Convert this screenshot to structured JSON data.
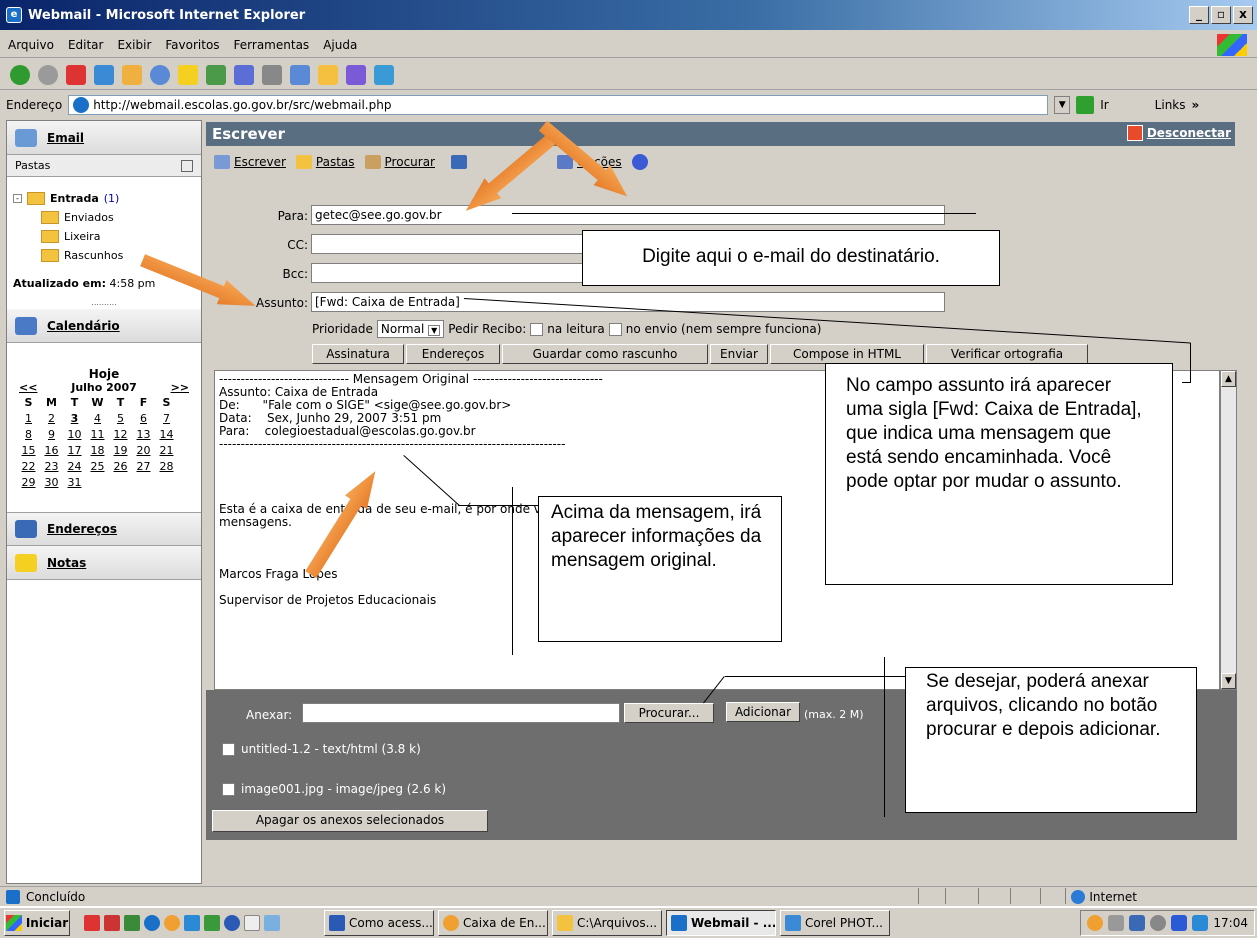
{
  "window": {
    "title": "Webmail - Microsoft Internet Explorer",
    "min": "_",
    "max": "\u0019",
    "close": "x"
  },
  "menu": [
    "Arquivo",
    "Editar",
    "Exibir",
    "Favoritos",
    "Ferramentas",
    "Ajuda"
  ],
  "address": {
    "label": "Endereço",
    "url": "http://webmail.escolas.go.gov.br/src/webmail.php",
    "go": "Ir",
    "links": "Links"
  },
  "left": {
    "email": "Email",
    "pastas": "Pastas",
    "folders": [
      {
        "name": "Entrada",
        "count": "(1)"
      },
      {
        "name": "Enviados"
      },
      {
        "name": "Lixeira"
      },
      {
        "name": "Rascunhos"
      }
    ],
    "updated_label": "Atualizado em:",
    "updated_time": "4:58 pm",
    "dots": "..........",
    "calendario": "Calendário",
    "hoje": "Hoje",
    "month": "Julho 2007",
    "prev": "<<",
    "next": ">>",
    "weekdays": [
      "S",
      "M",
      "T",
      "W",
      "T",
      "F",
      "S"
    ],
    "weeks": [
      [
        "1",
        "2",
        "3",
        "4",
        "5",
        "6",
        "7"
      ],
      [
        "8",
        "9",
        "10",
        "11",
        "12",
        "13",
        "14"
      ],
      [
        "15",
        "16",
        "17",
        "18",
        "19",
        "20",
        "21"
      ],
      [
        "22",
        "23",
        "24",
        "25",
        "26",
        "27",
        "28"
      ],
      [
        "29",
        "30",
        "31",
        "",
        "",
        "",
        ""
      ]
    ],
    "enderecos": "Endereços",
    "notas": "Notas"
  },
  "main": {
    "title": "Escrever",
    "disconnect": "Desconectar",
    "tb": [
      "Escrever",
      "Pastas",
      "Procurar",
      "Opções"
    ]
  },
  "form": {
    "para_label": "Para:",
    "para": "getec@see.go.gov.br",
    "cc_label": "CC:",
    "bcc_label": "Bcc:",
    "assunto_label": "Assunto:",
    "assunto": "[Fwd: Caixa de Entrada]",
    "prioridade": "Prioridade",
    "prioridade_val": "Normal",
    "pedir": "Pedir Recibo:",
    "na_leitura": "na leitura",
    "no_envio": "no envio (nem sempre funciona)",
    "buttons": [
      "Assinatura",
      "Endereços",
      "Guardar como rascunho",
      "Enviar",
      "Compose in HTML",
      "Verificar ortografia"
    ]
  },
  "message": {
    "lines": [
      "------------------------------ Mensagem Original ------------------------------",
      "Assunto: Caixa de Entrada",
      "De:      \"Fale com o SIGE\" <sige@see.go.gov.br>",
      "Data:    Sex, Junho 29, 2007 3:51 pm",
      "Para:    colegioestadual@escolas.go.gov.br",
      "--------------------------------------------------------------------------------",
      "",
      "",
      "",
      "",
      "Esta é a caixa de entrada de seu e-mail, é por onde v",
      "mensagens.",
      "",
      "",
      "",
      "Marcos Fraga Lopes",
      "",
      "Supervisor de Projetos Educacionais"
    ]
  },
  "attach": {
    "label": "Anexar:",
    "procurar": "Procurar...",
    "adicionar": "Adicionar",
    "max": "(max. 2 M)",
    "files": [
      "untitled-1.2 - text/html (3.8 k)",
      "image001.jpg - image/jpeg (2.6 k)"
    ],
    "apagar": "Apagar os anexos selecionados"
  },
  "callouts": {
    "c1": "Digite aqui o e-mail do destinatário.",
    "c2": "No campo assunto irá aparecer uma sigla [Fwd: Caixa de Entrada], que indica uma mensagem que está sendo encaminhada. Você pode optar por mudar o assunto.",
    "c3": "Acima da mensagem, irá aparecer informações da mensagem original.",
    "c4": "Se desejar, poderá anexar arquivos, clicando no botão procurar e depois adicionar."
  },
  "status": {
    "text": "Concluído",
    "zone": "Internet"
  },
  "taskbar": {
    "start": "Iniciar",
    "tasks": [
      "Como acess...",
      "Caixa de En...",
      "C:\\Arquivos...",
      "Webmail - ...",
      "Corel PHOT..."
    ],
    "clock": "17:04"
  }
}
